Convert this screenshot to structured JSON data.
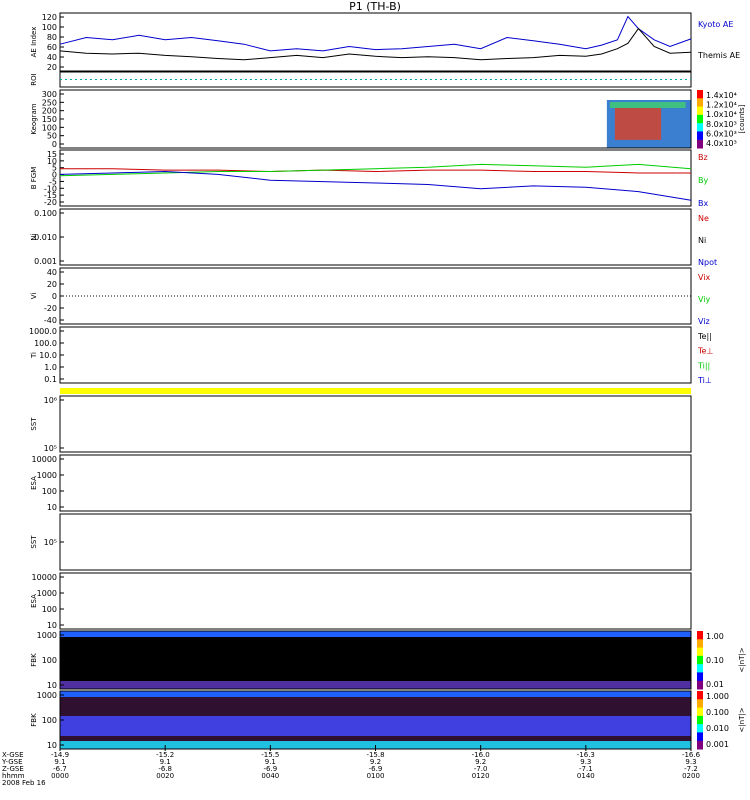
{
  "page": {
    "title": "P1  (TH-B)"
  },
  "bottom": {
    "rows": [
      "X-GSE",
      "Y-GSE",
      "Z-GSE",
      "hhmm",
      "2008 Feb 16"
    ],
    "times": [
      "0000",
      "0020",
      "0040",
      "0100",
      "0120",
      "0140",
      "0200"
    ],
    "xgse": [
      "-14.9",
      "-15.2",
      "-15.5",
      "-15.8",
      "-16.0",
      "-16.3",
      "-16.6"
    ],
    "ygse": [
      "9.1",
      "9.1",
      "9.1",
      "9.2",
      "9.2",
      "9.3",
      "9.3"
    ],
    "zgse": [
      "-6.7",
      "-6.8",
      "-6.9",
      "-6.9",
      "-7.0",
      "-7.1",
      "-7.2"
    ]
  },
  "chart_data": [
    {
      "id": "ae",
      "type": "line",
      "ylabel": "AE Index",
      "yticks": [
        "120",
        "100",
        "80",
        "60",
        "40",
        "20"
      ],
      "ylim": [
        0,
        130
      ],
      "series": [
        {
          "name": "Kyoto AE",
          "color": "#0000cc",
          "x": [
            0,
            5,
            10,
            15,
            20,
            25,
            30,
            35,
            40,
            45,
            50,
            55,
            60,
            65,
            70,
            75,
            80,
            85,
            90,
            95,
            100,
            103,
            106,
            108,
            110,
            113,
            116,
            120
          ],
          "y": [
            60,
            75,
            70,
            80,
            70,
            75,
            68,
            60,
            45,
            50,
            45,
            55,
            48,
            50,
            55,
            60,
            50,
            75,
            68,
            60,
            50,
            58,
            70,
            122,
            95,
            70,
            55,
            72
          ]
        },
        {
          "name": "Themis AE",
          "color": "#000000",
          "x": [
            0,
            5,
            10,
            15,
            20,
            25,
            30,
            35,
            40,
            45,
            50,
            55,
            60,
            65,
            70,
            75,
            80,
            85,
            90,
            95,
            100,
            103,
            106,
            108,
            110,
            113,
            116,
            120
          ],
          "y": [
            45,
            40,
            38,
            40,
            35,
            32,
            28,
            25,
            30,
            35,
            30,
            38,
            33,
            30,
            32,
            30,
            25,
            28,
            30,
            35,
            33,
            38,
            50,
            62,
            95,
            55,
            40,
            42
          ]
        }
      ]
    },
    {
      "id": "roi",
      "type": "line",
      "ylabel": "ROI",
      "series": [
        {
          "name": "",
          "color": "#00aaaa",
          "x": [
            0,
            120
          ],
          "y": [
            0,
            0
          ]
        }
      ]
    },
    {
      "id": "keogram",
      "type": "heatmap",
      "ylabel": "Keogram",
      "yticks": [
        "300",
        "250",
        "200",
        "150",
        "100",
        "50",
        "0"
      ],
      "ylim": [
        0,
        300
      ],
      "colorbar": {
        "label": "[counts]",
        "ticks": [
          "1.4x10⁴",
          "1.2x10⁴",
          "1.0x10⁴",
          "8.0x10³",
          "6.0x10³",
          "4.0x10³"
        ]
      },
      "data_x_range": [
        104,
        120
      ]
    },
    {
      "id": "bfgm",
      "type": "line",
      "ylabel": "B FGM",
      "yticks": [
        "15",
        "10",
        "5",
        "0",
        "-5",
        "-10",
        "-15",
        "-20"
      ],
      "ylim": [
        -22,
        17
      ],
      "series": [
        {
          "name": "Bz",
          "color": "#cc0000",
          "x": [
            0,
            10,
            20,
            30,
            40,
            50,
            60,
            70,
            80,
            90,
            100,
            110,
            120
          ],
          "y": [
            4,
            4,
            3,
            3,
            2,
            3,
            2,
            3,
            3,
            2,
            2,
            1,
            1
          ]
        },
        {
          "name": "By",
          "color": "#00cc00",
          "x": [
            0,
            10,
            20,
            30,
            40,
            50,
            60,
            70,
            80,
            90,
            100,
            110,
            120
          ],
          "y": [
            -1,
            0,
            1,
            2,
            2,
            3,
            4,
            5,
            7,
            6,
            5,
            7,
            4
          ]
        },
        {
          "name": "Bx",
          "color": "#0000cc",
          "x": [
            0,
            10,
            20,
            30,
            40,
            50,
            60,
            70,
            80,
            90,
            100,
            110,
            120
          ],
          "y": [
            0,
            1,
            2,
            0,
            -4,
            -5,
            -6,
            -7,
            -10,
            -8,
            -9,
            -12,
            -18
          ]
        }
      ]
    },
    {
      "id": "ni",
      "type": "line",
      "ylabel": "Ni",
      "yticks": [
        "0.100",
        "0.010",
        "0.001"
      ],
      "legend": [
        {
          "name": "Ne",
          "color": "#cc0000"
        },
        {
          "name": "Ni",
          "color": "#000000"
        },
        {
          "name": "Npot",
          "color": "#0000cc"
        }
      ]
    },
    {
      "id": "vi",
      "type": "line",
      "ylabel": "Vi",
      "yticks": [
        "40",
        "20",
        "0",
        "-20",
        "-40"
      ],
      "ylim": [
        -50,
        50
      ],
      "legend": [
        {
          "name": "Vix",
          "color": "#cc0000"
        },
        {
          "name": "Viy",
          "color": "#00cc00"
        },
        {
          "name": "Viz",
          "color": "#0000cc"
        }
      ]
    },
    {
      "id": "ti",
      "type": "line",
      "ylabel": "Ti",
      "yticks": [
        "1000.0",
        "100.0",
        "10.0",
        "1.0",
        "0.1"
      ],
      "legend": [
        {
          "name": "Te||",
          "color": "#000000"
        },
        {
          "name": "Te⊥",
          "color": "#cc0000"
        },
        {
          "name": "Ti||",
          "color": "#00cc00"
        },
        {
          "name": "Ti⊥",
          "color": "#0000cc"
        }
      ]
    },
    {
      "id": "sst1",
      "type": "heatmap",
      "ylabel": "SST",
      "yticks": [
        "10⁶",
        "10⁵"
      ]
    },
    {
      "id": "esa1",
      "type": "heatmap",
      "ylabel": "ESA",
      "yticks": [
        "10000",
        "1000",
        "100",
        "10"
      ]
    },
    {
      "id": "sst2",
      "type": "heatmap",
      "ylabel": "SST",
      "yticks": [
        "10⁵"
      ]
    },
    {
      "id": "esa2",
      "type": "heatmap",
      "ylabel": "ESA",
      "yticks": [
        "10000",
        "1000",
        "100",
        "10"
      ]
    },
    {
      "id": "fbk1",
      "type": "heatmap",
      "ylabel": "FBK",
      "yticks": [
        "1000",
        "100",
        "10"
      ],
      "colorbar": {
        "label": "<|nT|>",
        "ticks": [
          "1.00",
          "0.10",
          "0.01"
        ]
      }
    },
    {
      "id": "fbk2",
      "type": "heatmap",
      "ylabel": "FBK",
      "yticks": [
        "1000",
        "100",
        "10"
      ],
      "colorbar": {
        "label": "<|nT|>",
        "ticks": [
          "1.000",
          "0.100",
          "0.010",
          "0.001"
        ]
      }
    }
  ]
}
